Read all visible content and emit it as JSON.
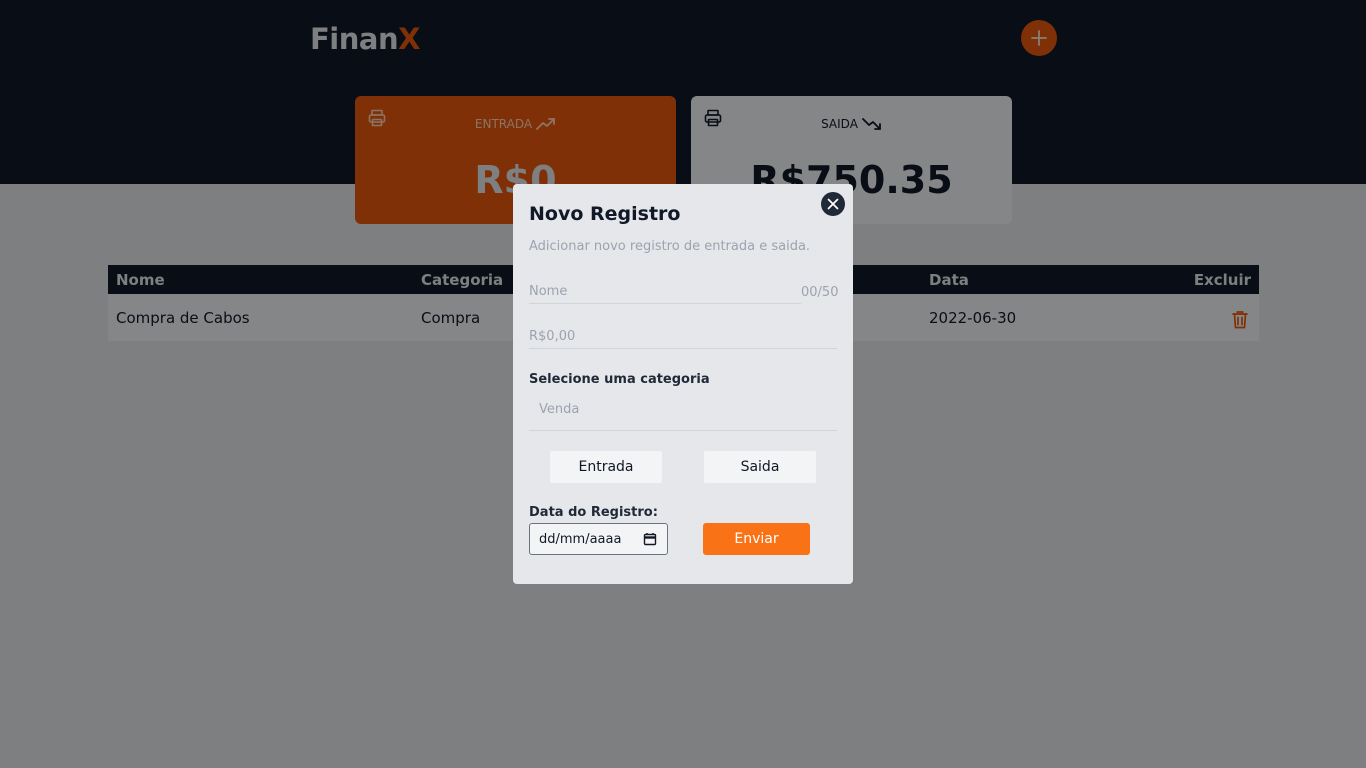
{
  "header": {
    "logo_main": "Finan",
    "logo_accent": "X"
  },
  "summary": {
    "entrada": {
      "label": "ENTRADA",
      "amount": "R$0"
    },
    "saida": {
      "label": "SAIDA",
      "amount": "R$750.35"
    }
  },
  "table": {
    "columns": {
      "nome": "Nome",
      "categoria": "Categoria",
      "data": "Data",
      "excluir": "Excluir"
    },
    "rows": [
      {
        "nome": "Compra de Cabos",
        "categoria": "Compra",
        "data": "2022-06-30"
      }
    ]
  },
  "modal": {
    "title": "Novo Registro",
    "subtitle": "Adicionar novo registro de entrada e saida.",
    "name_placeholder": "Nome",
    "name_counter": "00/50",
    "value_placeholder": "R$0,00",
    "category_label": "Selecione uma categoria",
    "category_selected": "Venda",
    "btn_entrada": "Entrada",
    "btn_saida": "Saida",
    "date_label": "Data do Registro:",
    "date_placeholder": "dd/mm/aaaa",
    "submit_label": "Enviar"
  },
  "colors": {
    "accent": "#ea580c",
    "header_bg": "#111827",
    "submit": "#f97316"
  },
  "icons": [
    "plus-icon",
    "printer-icon",
    "trending-up-icon",
    "trending-down-icon",
    "trash-icon",
    "close-icon",
    "calendar-icon"
  ]
}
